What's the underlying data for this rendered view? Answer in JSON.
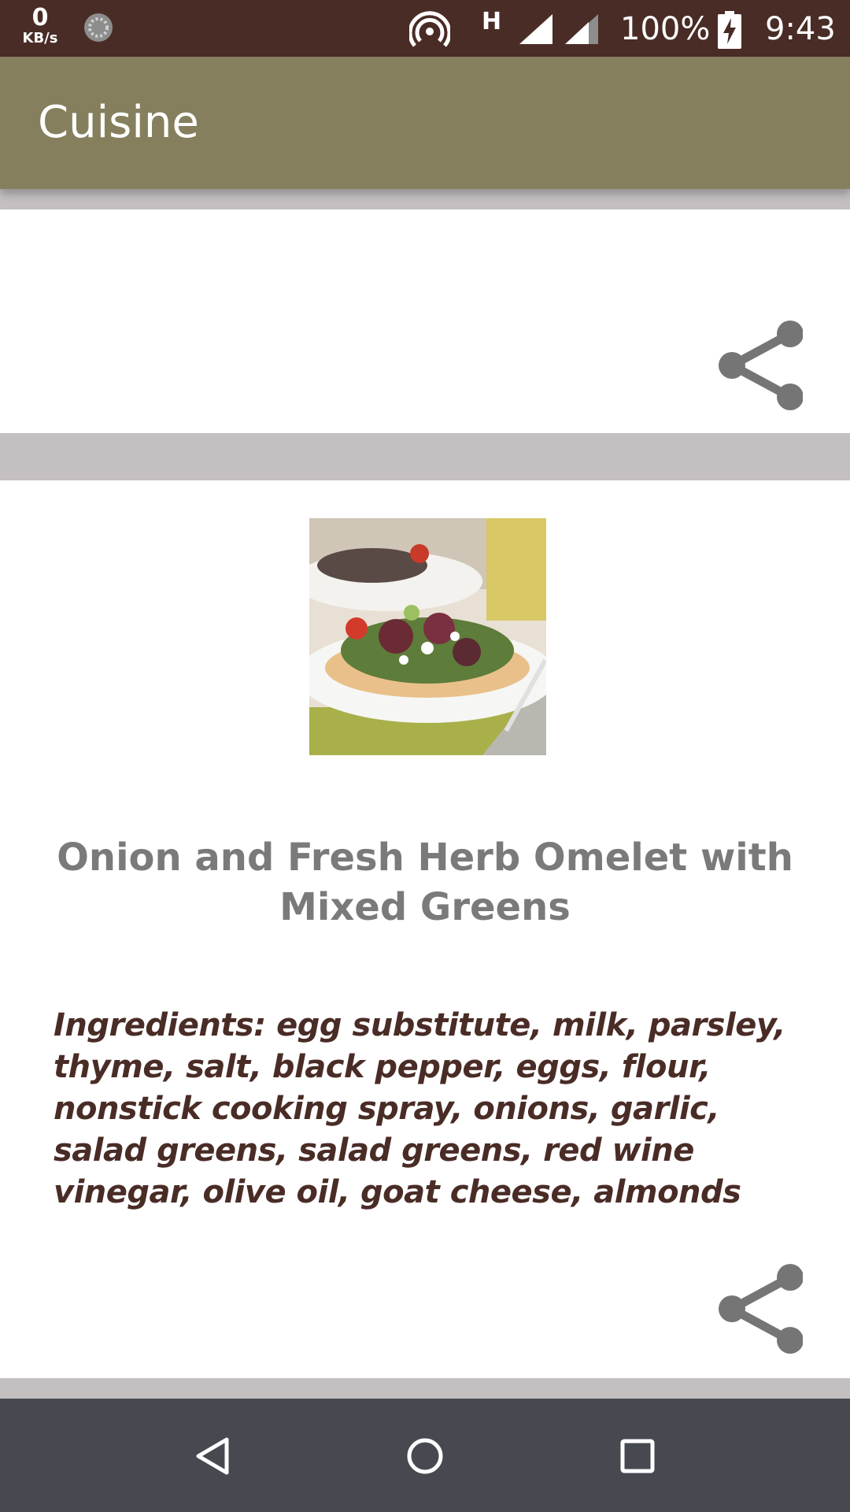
{
  "status_bar": {
    "net_speed_value": "0",
    "net_speed_unit": "KB/s",
    "network_type": "H",
    "battery": "100%",
    "time": "9:43"
  },
  "app_bar": {
    "title": "Cuisine"
  },
  "recipe": {
    "title": "Onion and Fresh Herb Omelet with Mixed Greens",
    "ingredients": "Ingredients: egg substitute, milk, parsley, thyme, salt, black pepper, eggs, flour, nonstick cooking spray, onions, garlic, salad greens, salad greens, red wine vinegar, olive oil, goat cheese, almonds"
  },
  "colors": {
    "status_bar": "#4a2c26",
    "app_bar": "#857f5e",
    "divider": "#c4bfc0",
    "title_text": "#7a7a7a",
    "ingredients_text": "#4a2c26",
    "icon": "#757575",
    "nav_bar": "#464a50"
  },
  "icons": {
    "share": "share-icon",
    "back": "back-icon",
    "home": "home-icon",
    "recents": "recents-icon"
  }
}
